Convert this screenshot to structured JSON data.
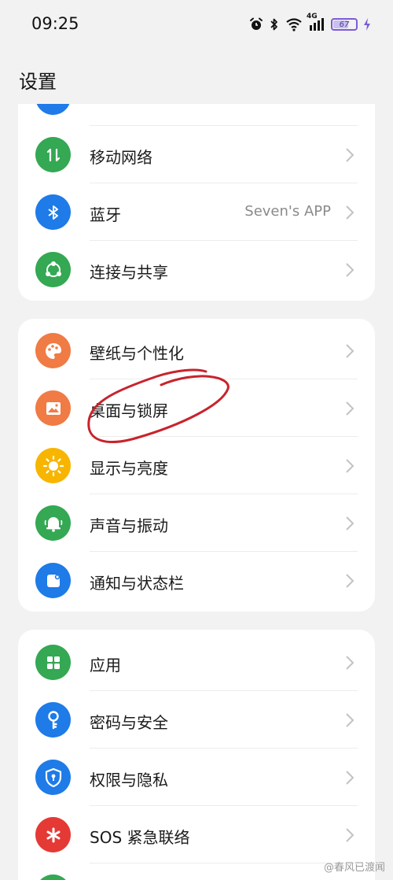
{
  "status_bar": {
    "time": "09:25",
    "network": "4G",
    "battery": "67",
    "battery_level": 0.67
  },
  "header": {
    "title": "设置"
  },
  "cards": [
    {
      "items": [
        {
          "label": "移动网络",
          "value": "",
          "icon": "mobile-data-icon",
          "color": "#34a853"
        },
        {
          "label": "蓝牙",
          "value": "Seven's APP",
          "icon": "bluetooth-icon",
          "color": "#1e7be8"
        },
        {
          "label": "连接与共享",
          "value": "",
          "icon": "share-icon",
          "color": "#34a853"
        }
      ]
    },
    {
      "items": [
        {
          "label": "壁纸与个性化",
          "value": "",
          "icon": "palette-icon",
          "color": "#f07b45"
        },
        {
          "label": "桌面与锁屏",
          "value": "",
          "icon": "wallpaper-icon",
          "color": "#f07b45"
        },
        {
          "label": "显示与亮度",
          "value": "",
          "icon": "sun-icon",
          "color": "#f7b500"
        },
        {
          "label": "声音与振动",
          "value": "",
          "icon": "bell-icon",
          "color": "#34a853"
        },
        {
          "label": "通知与状态栏",
          "value": "",
          "icon": "notification-icon",
          "color": "#1e7be8"
        }
      ]
    },
    {
      "items": [
        {
          "label": "应用",
          "value": "",
          "icon": "apps-grid-icon",
          "color": "#34a853"
        },
        {
          "label": "密码与安全",
          "value": "",
          "icon": "key-icon",
          "color": "#1e7be8"
        },
        {
          "label": "权限与隐私",
          "value": "",
          "icon": "shield-lock-icon",
          "color": "#1e7be8"
        },
        {
          "label": "SOS 紧急联络",
          "value": "",
          "icon": "sos-asterisk-icon",
          "color": "#e53935"
        }
      ]
    }
  ],
  "watermark": "@春风已渡闻",
  "colors": {
    "background": "#f2f2f2",
    "card": "#ffffff",
    "annotation": "#c8232c"
  }
}
